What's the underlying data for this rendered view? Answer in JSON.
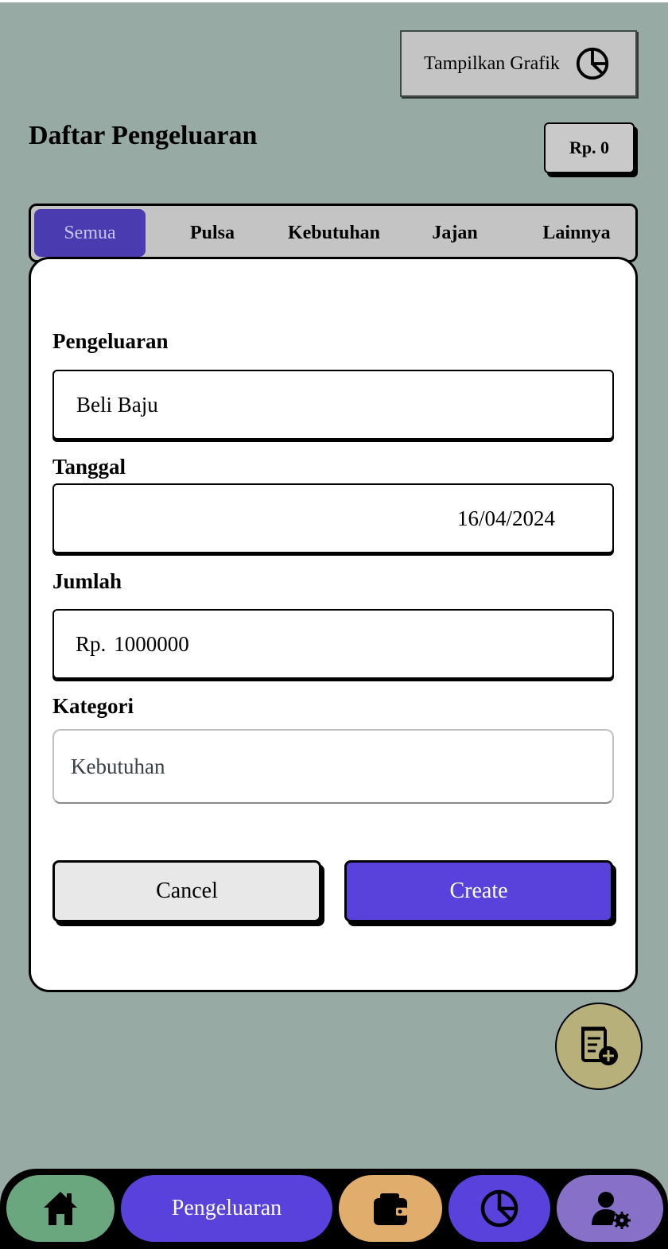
{
  "header": {
    "chart_button_label": "Tampilkan Grafik",
    "title": "Daftar Pengeluaran",
    "total": "Rp. 0"
  },
  "tabs": [
    {
      "label": "Semua",
      "active": true
    },
    {
      "label": "Pulsa",
      "active": false
    },
    {
      "label": "Kebutuhan",
      "active": false
    },
    {
      "label": "Jajan",
      "active": false
    },
    {
      "label": "Lainnya",
      "active": false
    }
  ],
  "form": {
    "expense_label": "Pengeluaran",
    "expense_value": "Beli Baju",
    "date_label": "Tanggal",
    "date_value": "16/04/2024",
    "amount_label": "Jumlah",
    "amount_prefix": "Rp.",
    "amount_value": "1000000",
    "category_label": "Kategori",
    "category_value": "Kebutuhan",
    "cancel_label": "Cancel",
    "create_label": "Create"
  },
  "fab": {
    "icon": "add-expense-icon"
  },
  "bottom_nav": {
    "items": [
      {
        "icon": "home-icon",
        "color": "#6aa67e"
      },
      {
        "label": "Pengeluaran",
        "color": "#5942dc"
      },
      {
        "icon": "wallet-icon",
        "color": "#e0ad6c"
      },
      {
        "icon": "pie-chart-icon",
        "color": "#5942dc"
      },
      {
        "icon": "user-settings-icon",
        "color": "#8670c8"
      }
    ]
  },
  "colors": {
    "background": "#97aaa4",
    "accent": "#5942dc",
    "active_tab": "#4a3cb0",
    "fab": "#b8b07a"
  }
}
